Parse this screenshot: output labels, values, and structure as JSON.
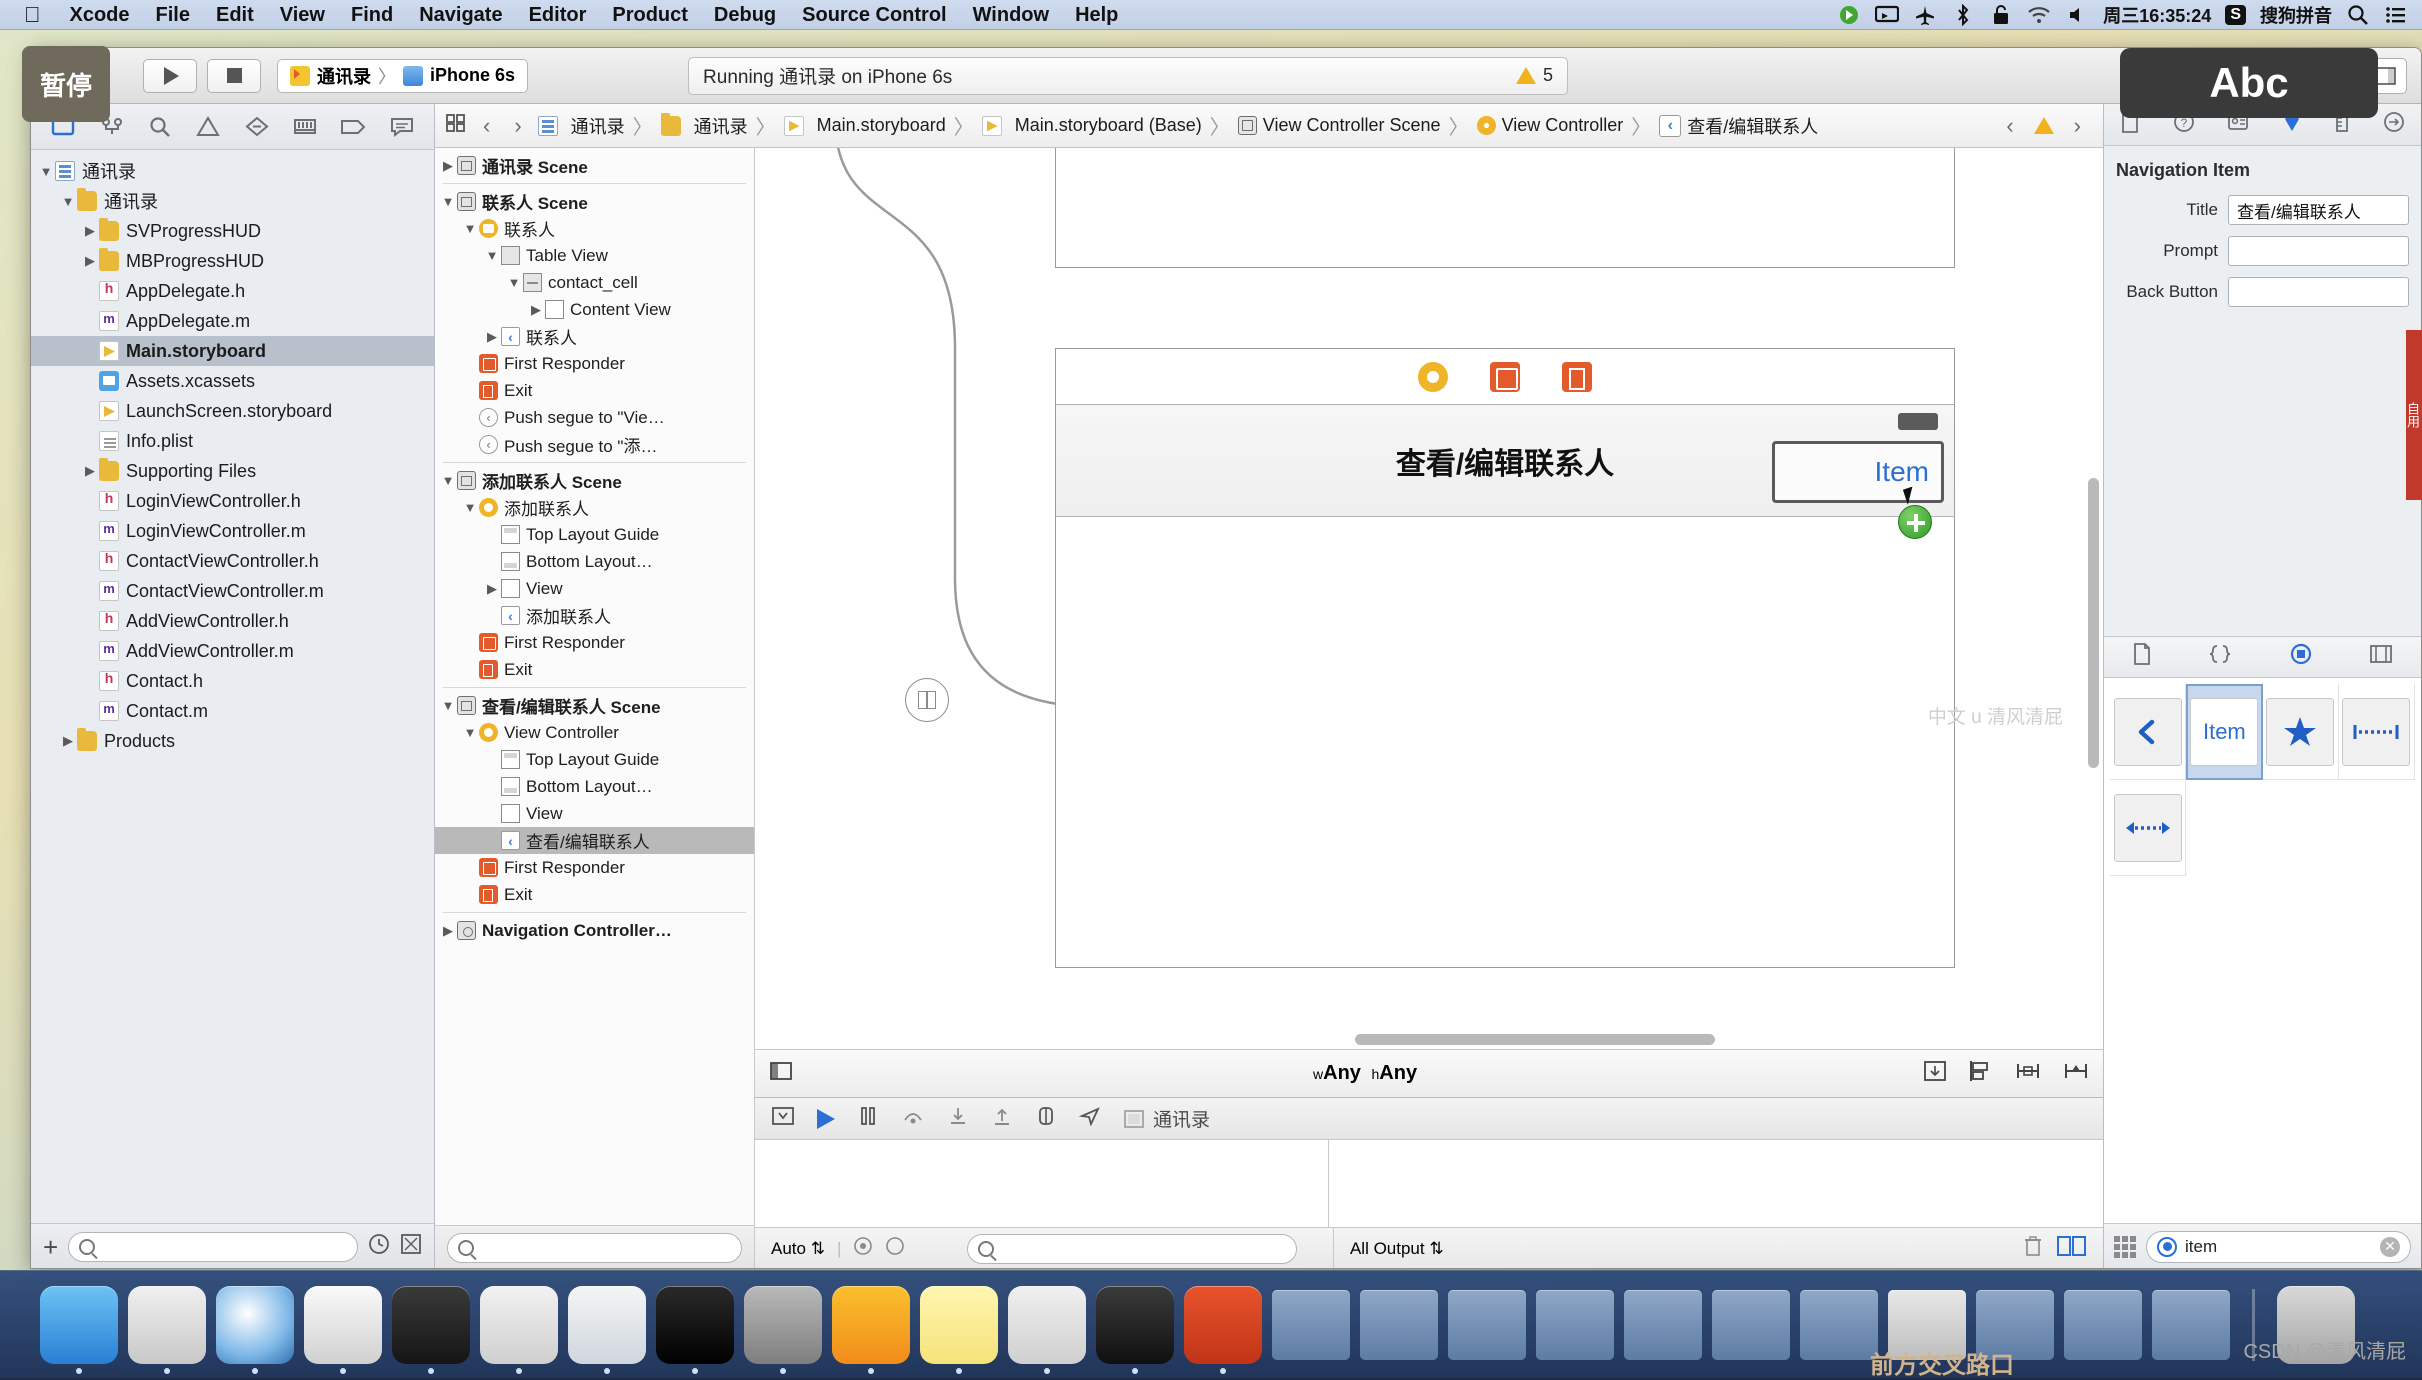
{
  "menubar": {
    "apple_icon": "apple-icon",
    "items": [
      "Xcode",
      "File",
      "Edit",
      "View",
      "Find",
      "Navigate",
      "Editor",
      "Product",
      "Debug",
      "Source Control",
      "Window",
      "Help"
    ],
    "status_icons": [
      "screen-record-icon",
      "airplay-icon",
      "bluetooth-icon",
      "lock-icon",
      "wifi-icon",
      "volume-icon"
    ],
    "clock": "周三16:35:24",
    "input_method_badge": "S",
    "input_method": "搜狗拼音",
    "spotlight_icon": "search-icon",
    "notification_icon": "list-icon"
  },
  "tooltips": {
    "pause": "暂停",
    "abc": "Abc"
  },
  "toolbar": {
    "run_icon": "play-icon",
    "stop_icon": "stop-icon",
    "scheme_project": "通讯录",
    "scheme_separator": "〉",
    "scheme_device": "iPhone 6s",
    "status_text": "Running 通讯录 on iPhone 6s",
    "warning_count": "5",
    "warning_icon": "warning-triangle-icon"
  },
  "navigator": {
    "tabs": [
      {
        "name": "project-navigator",
        "icon": "folder-outline-icon",
        "active": true
      },
      {
        "name": "source-control-navigator",
        "icon": "source-control-icon",
        "active": false
      },
      {
        "name": "symbol-navigator",
        "icon": "search-icon",
        "active": false
      },
      {
        "name": "issue-navigator",
        "icon": "warning-triangle-icon",
        "active": false
      },
      {
        "name": "test-navigator",
        "icon": "diamond-icon",
        "active": false
      },
      {
        "name": "debug-navigator",
        "icon": "debug-icon",
        "active": false
      },
      {
        "name": "breakpoint-navigator",
        "icon": "breakpoint-icon",
        "active": false
      },
      {
        "name": "report-navigator",
        "icon": "report-icon",
        "active": false
      }
    ],
    "tree": [
      {
        "label": "通讯录",
        "icon": "project-icon",
        "depth": 0,
        "twisty": "open",
        "selected": false
      },
      {
        "label": "通讯录",
        "icon": "folder-icon",
        "depth": 1,
        "twisty": "open",
        "selected": false
      },
      {
        "label": "SVProgressHUD",
        "icon": "folder-icon",
        "depth": 2,
        "twisty": "closed",
        "selected": false
      },
      {
        "label": "MBProgressHUD",
        "icon": "folder-icon",
        "depth": 2,
        "twisty": "closed",
        "selected": false
      },
      {
        "label": "AppDelegate.h",
        "icon": "header-file-icon",
        "depth": 2,
        "twisty": "",
        "selected": false
      },
      {
        "label": "AppDelegate.m",
        "icon": "source-file-icon",
        "depth": 2,
        "twisty": "",
        "selected": false
      },
      {
        "label": "Main.storyboard",
        "icon": "storyboard-icon",
        "depth": 2,
        "twisty": "",
        "selected": true
      },
      {
        "label": "Assets.xcassets",
        "icon": "xcassets-icon",
        "depth": 2,
        "twisty": "",
        "selected": false
      },
      {
        "label": "LaunchScreen.storyboard",
        "icon": "storyboard-icon",
        "depth": 2,
        "twisty": "",
        "selected": false
      },
      {
        "label": "Info.plist",
        "icon": "plist-icon",
        "depth": 2,
        "twisty": "",
        "selected": false
      },
      {
        "label": "Supporting Files",
        "icon": "folder-icon",
        "depth": 2,
        "twisty": "closed",
        "selected": false
      },
      {
        "label": "LoginViewController.h",
        "icon": "header-file-icon",
        "depth": 2,
        "twisty": "",
        "selected": false
      },
      {
        "label": "LoginViewController.m",
        "icon": "source-file-icon",
        "depth": 2,
        "twisty": "",
        "selected": false
      },
      {
        "label": "ContactViewController.h",
        "icon": "header-file-icon",
        "depth": 2,
        "twisty": "",
        "selected": false
      },
      {
        "label": "ContactViewController.m",
        "icon": "source-file-icon",
        "depth": 2,
        "twisty": "",
        "selected": false
      },
      {
        "label": "AddViewController.h",
        "icon": "header-file-icon",
        "depth": 2,
        "twisty": "",
        "selected": false
      },
      {
        "label": "AddViewController.m",
        "icon": "source-file-icon",
        "depth": 2,
        "twisty": "",
        "selected": false
      },
      {
        "label": "Contact.h",
        "icon": "header-file-icon",
        "depth": 2,
        "twisty": "",
        "selected": false
      },
      {
        "label": "Contact.m",
        "icon": "source-file-icon",
        "depth": 2,
        "twisty": "",
        "selected": false
      },
      {
        "label": "Products",
        "icon": "folder-icon",
        "depth": 1,
        "twisty": "closed",
        "selected": false
      }
    ],
    "filter_placeholder": ""
  },
  "jumpbar": {
    "related_icon": "related-items-icon",
    "back_icon": "chevron-left-icon",
    "forward_icon": "chevron-right-icon",
    "crumbs": [
      {
        "label": "通讯录",
        "icon": "project-icon"
      },
      {
        "label": "通讯录",
        "icon": "folder-icon"
      },
      {
        "label": "Main.storyboard",
        "icon": "storyboard-icon"
      },
      {
        "label": "Main.storyboard (Base)",
        "icon": "storyboard-icon"
      },
      {
        "label": "View Controller Scene",
        "icon": "scene-icon"
      },
      {
        "label": "View Controller",
        "icon": "view-controller-icon"
      },
      {
        "label": "查看/编辑联系人",
        "icon": "back-button-icon"
      }
    ],
    "prev_issue_icon": "chevron-left-icon",
    "issue_icon": "warning-triangle-icon",
    "next_issue_icon": "chevron-right-icon"
  },
  "outline": {
    "rows": [
      {
        "label": "通讯录 Scene",
        "icon": "scene-icon",
        "depth": 0,
        "twisty": "closed",
        "selected": false,
        "bold": true
      },
      {
        "divider": true
      },
      {
        "label": "联系人 Scene",
        "icon": "scene-icon",
        "depth": 0,
        "twisty": "open",
        "selected": false,
        "bold": true
      },
      {
        "label": "联系人",
        "icon": "view-controller-window-icon",
        "depth": 1,
        "twisty": "open",
        "selected": false
      },
      {
        "label": "Table View",
        "icon": "table-view-icon",
        "depth": 2,
        "twisty": "open",
        "selected": false
      },
      {
        "label": "contact_cell",
        "icon": "table-cell-icon",
        "depth": 3,
        "twisty": "open",
        "selected": false
      },
      {
        "label": "Content View",
        "icon": "view-icon",
        "depth": 4,
        "twisty": "closed",
        "selected": false
      },
      {
        "label": "联系人",
        "icon": "back-button-icon",
        "depth": 2,
        "twisty": "closed",
        "selected": false
      },
      {
        "label": "First Responder",
        "icon": "first-responder-icon",
        "depth": 1,
        "twisty": "",
        "selected": false
      },
      {
        "label": "Exit",
        "icon": "exit-icon",
        "depth": 1,
        "twisty": "",
        "selected": false
      },
      {
        "label": "Push segue to \"Vie…",
        "icon": "segue-icon",
        "depth": 1,
        "twisty": "",
        "selected": false
      },
      {
        "label": "Push segue to \"添…",
        "icon": "segue-icon",
        "depth": 1,
        "twisty": "",
        "selected": false
      },
      {
        "divider": true
      },
      {
        "label": "添加联系人 Scene",
        "icon": "scene-icon",
        "depth": 0,
        "twisty": "open",
        "selected": false,
        "bold": true
      },
      {
        "label": "添加联系人",
        "icon": "view-controller-icon",
        "depth": 1,
        "twisty": "open",
        "selected": false
      },
      {
        "label": "Top Layout Guide",
        "icon": "top-layout-guide-icon",
        "depth": 2,
        "twisty": "",
        "selected": false
      },
      {
        "label": "Bottom Layout…",
        "icon": "bottom-layout-guide-icon",
        "depth": 2,
        "twisty": "",
        "selected": false
      },
      {
        "label": "View",
        "icon": "view-icon",
        "depth": 2,
        "twisty": "closed",
        "selected": false
      },
      {
        "label": "添加联系人",
        "icon": "back-button-icon",
        "depth": 2,
        "twisty": "",
        "selected": false
      },
      {
        "label": "First Responder",
        "icon": "first-responder-icon",
        "depth": 1,
        "twisty": "",
        "selected": false
      },
      {
        "label": "Exit",
        "icon": "exit-icon",
        "depth": 1,
        "twisty": "",
        "selected": false
      },
      {
        "divider": true
      },
      {
        "label": "查看/编辑联系人 Scene",
        "icon": "scene-icon",
        "depth": 0,
        "twisty": "open",
        "selected": false,
        "bold": true
      },
      {
        "label": "View Controller",
        "icon": "view-controller-icon",
        "depth": 1,
        "twisty": "open",
        "selected": false
      },
      {
        "label": "Top Layout Guide",
        "icon": "top-layout-guide-icon",
        "depth": 2,
        "twisty": "",
        "selected": false
      },
      {
        "label": "Bottom Layout…",
        "icon": "bottom-layout-guide-icon",
        "depth": 2,
        "twisty": "",
        "selected": false
      },
      {
        "label": "View",
        "icon": "view-icon",
        "depth": 2,
        "twisty": "",
        "selected": false
      },
      {
        "label": "查看/编辑联系人",
        "icon": "back-button-icon",
        "depth": 2,
        "twisty": "",
        "selected": true
      },
      {
        "label": "First Responder",
        "icon": "first-responder-icon",
        "depth": 1,
        "twisty": "",
        "selected": false
      },
      {
        "label": "Exit",
        "icon": "exit-icon",
        "depth": 1,
        "twisty": "",
        "selected": false
      },
      {
        "divider": true
      },
      {
        "label": "Navigation Controller…",
        "icon": "navigation-controller-icon",
        "depth": 0,
        "twisty": "closed",
        "selected": false,
        "bold": true
      }
    ],
    "filter_placeholder": ""
  },
  "canvas": {
    "scene_title": "查看/编辑联系人",
    "bar_button_label": "Item",
    "dock_icons": [
      "view-controller-icon",
      "first-responder-icon",
      "exit-icon"
    ],
    "size_class_w": "w",
    "size_class_w_value": "Any",
    "size_class_h": "h",
    "size_class_h_value": "Any",
    "bottom_icons": [
      "nesting-icon",
      "align-icon",
      "pin-icon",
      "resolve-icon"
    ]
  },
  "debug": {
    "toolbar_icons": [
      "hide-console-icon",
      "continue-icon",
      "pause-icon",
      "step-over-icon",
      "step-into-icon",
      "step-out-icon",
      "view-debug-icon",
      "location-icon"
    ],
    "process_label": "通讯录",
    "variables_scope": "Auto",
    "console_scope": "All Output",
    "console_filter_placeholder": "",
    "trash_icon": "trash-icon",
    "split_icon": "split-panes-icon"
  },
  "inspector": {
    "tabs": [
      {
        "name": "file-inspector",
        "icon": "document-icon",
        "active": false
      },
      {
        "name": "quick-help-inspector",
        "icon": "question-icon",
        "active": false
      },
      {
        "name": "identity-inspector",
        "icon": "identity-icon",
        "active": false
      },
      {
        "name": "attributes-inspector",
        "icon": "attributes-icon",
        "active": true
      },
      {
        "name": "size-inspector",
        "icon": "ruler-icon",
        "active": false
      },
      {
        "name": "connections-inspector",
        "icon": "arrow-circle-icon",
        "active": false
      }
    ],
    "section_title": "Navigation Item",
    "fields": [
      {
        "label": "Title",
        "value": "查看/编辑联系人",
        "placeholder": ""
      },
      {
        "label": "Prompt",
        "value": "",
        "placeholder": ""
      },
      {
        "label": "Back Button",
        "value": "",
        "placeholder": ""
      }
    ]
  },
  "library": {
    "tabs": [
      {
        "name": "file-template-library",
        "icon": "document-icon",
        "active": false
      },
      {
        "name": "code-snippet-library",
        "icon": "braces-icon",
        "active": false
      },
      {
        "name": "object-library",
        "icon": "circle-target-icon",
        "active": true
      },
      {
        "name": "media-library",
        "icon": "media-icon",
        "active": false
      }
    ],
    "items": [
      {
        "name": "bar-button-item-back",
        "glyph": "chevron-left-icon",
        "selected": false
      },
      {
        "name": "bar-button-item",
        "glyph": "Item",
        "selected": true
      },
      {
        "name": "bar-button-item-star",
        "glyph": "star-icon",
        "selected": false
      },
      {
        "name": "fixed-space-bar-button-item",
        "glyph": "fixed-space-icon",
        "selected": false
      },
      {
        "name": "flexible-space-bar-button-item",
        "glyph": "flexible-space-icon",
        "selected": false
      }
    ],
    "view_mode_icon": "grid-icon",
    "search_value": "item",
    "search_placeholder": "",
    "clear_icon": "clear-icon"
  },
  "watermarks": {
    "bottom_right": "CSDN @清风清屁",
    "canvas": "中文 u 清风清屁",
    "side": "自用",
    "bottom_center": "前方交叉路口"
  }
}
